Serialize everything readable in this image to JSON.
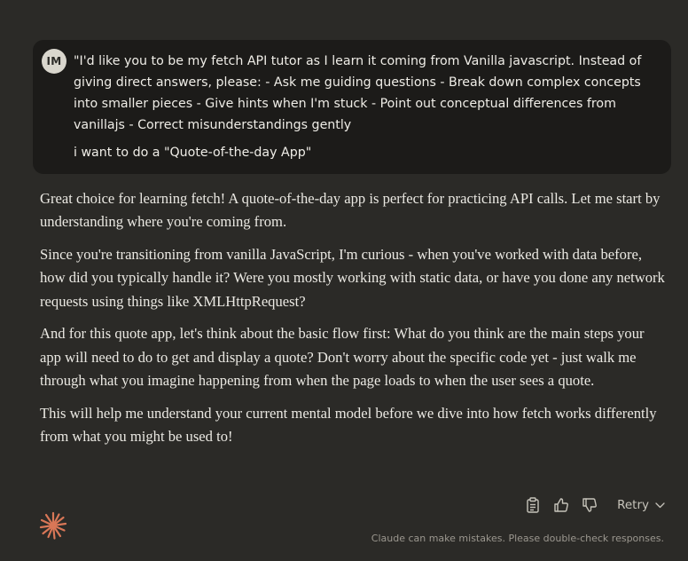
{
  "user_message": {
    "avatar_initials": "IM",
    "paragraphs": [
      "\"I'd like you to be my fetch API tutor as I learn it coming from Vanilla javascript. Instead of giving direct answers, please: - Ask me guiding questions - Break down complex concepts into smaller pieces - Give hints when I'm stuck - Point out conceptual differences from vanillajs - Correct misunderstandings gently",
      "i want to do a \"Quote-of-the-day App\""
    ]
  },
  "assistant_message": {
    "paragraphs": [
      "Great choice for learning fetch! A quote-of-the-day app is perfect for practicing API calls. Let me start by understanding where you're coming from.",
      "Since you're transitioning from vanilla JavaScript, I'm curious - when you've worked with data before, how did you typically handle it? Were you mostly working with static data, or have you done any network requests using things like XMLHttpRequest?",
      "And for this quote app, let's think about the basic flow first: What do you think are the main steps your app will need to do to get and display a quote? Don't worry about the specific code yet - just walk me through what you imagine happening from when the page loads to when the user sees a quote.",
      "This will help me understand your current mental model before we dive into how fetch works differently from what you might be used to!"
    ]
  },
  "actions": {
    "copy_icon": "clipboard-icon",
    "thumbs_up_icon": "thumbs-up-icon",
    "thumbs_down_icon": "thumbs-down-icon",
    "retry_label": "Retry"
  },
  "footer": {
    "disclaimer": "Claude can make mistakes. Please double-check responses."
  },
  "colors": {
    "background": "#2b2a27",
    "user_bubble": "#1c1b19",
    "brand_accent": "#d97757"
  }
}
